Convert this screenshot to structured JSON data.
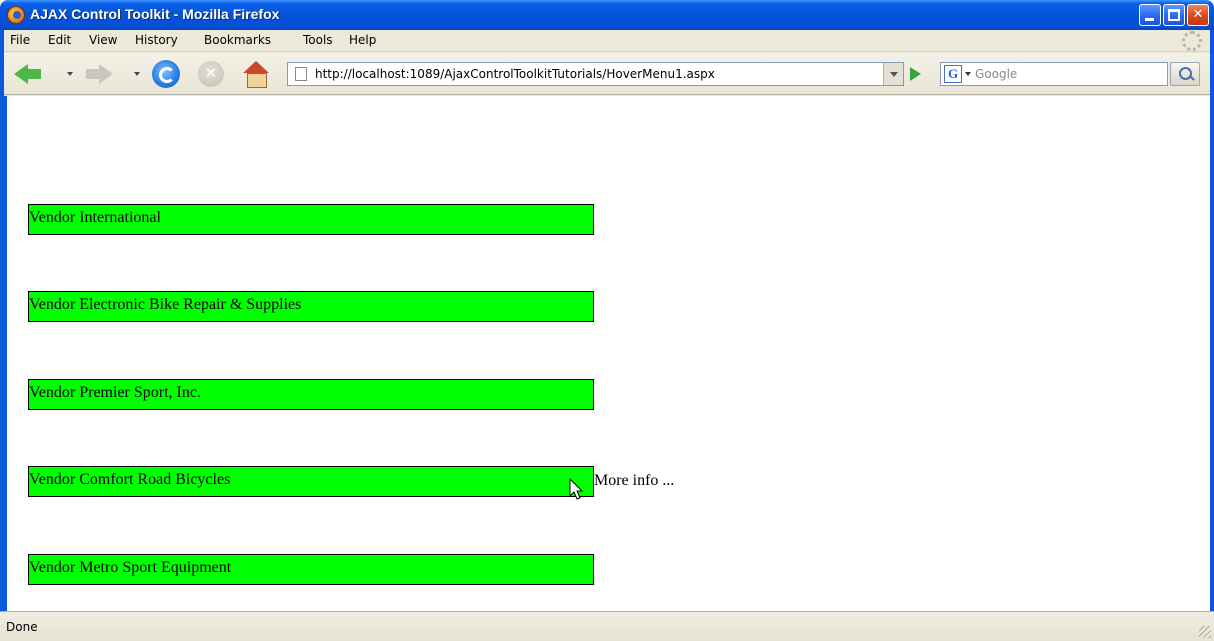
{
  "window": {
    "title": "AJAX Control Toolkit - Mozilla Firefox",
    "icons": {
      "app": "firefox-icon",
      "minimize": "minimize-icon",
      "maximize": "maximize-icon",
      "close": "close-icon"
    },
    "close_glyph": "✕"
  },
  "menu": {
    "items": [
      {
        "label": "File"
      },
      {
        "label": "Edit"
      },
      {
        "label": "View"
      },
      {
        "label": "History"
      },
      {
        "label": "Bookmarks"
      },
      {
        "label": "Tools"
      },
      {
        "label": "Help"
      }
    ]
  },
  "navigation": {
    "url": "http://localhost:1089/AjaxControlToolkitTutorials/HoverMenu1.aspx",
    "stop_glyph": "✕",
    "search_engine_glyph": "G",
    "search_placeholder": "Google",
    "icons": {
      "back": "back-arrow-icon",
      "forward": "forward-arrow-icon",
      "reload": "reload-icon",
      "stop": "stop-icon",
      "home": "home-icon",
      "page": "page-icon",
      "go": "go-arrow-icon",
      "search": "magnifier-icon"
    }
  },
  "content": {
    "vendors": [
      {
        "label": "Vendor International"
      },
      {
        "label": "Vendor Electronic Bike Repair & Supplies"
      },
      {
        "label": "Vendor Premier Sport, Inc."
      },
      {
        "label": "Vendor Comfort Road Bicycles"
      },
      {
        "label": "Vendor Metro Sport Equipment"
      }
    ],
    "hover_menu_text": "More info ...",
    "panel_color": "#00ff00"
  },
  "status": {
    "text": "Done"
  }
}
